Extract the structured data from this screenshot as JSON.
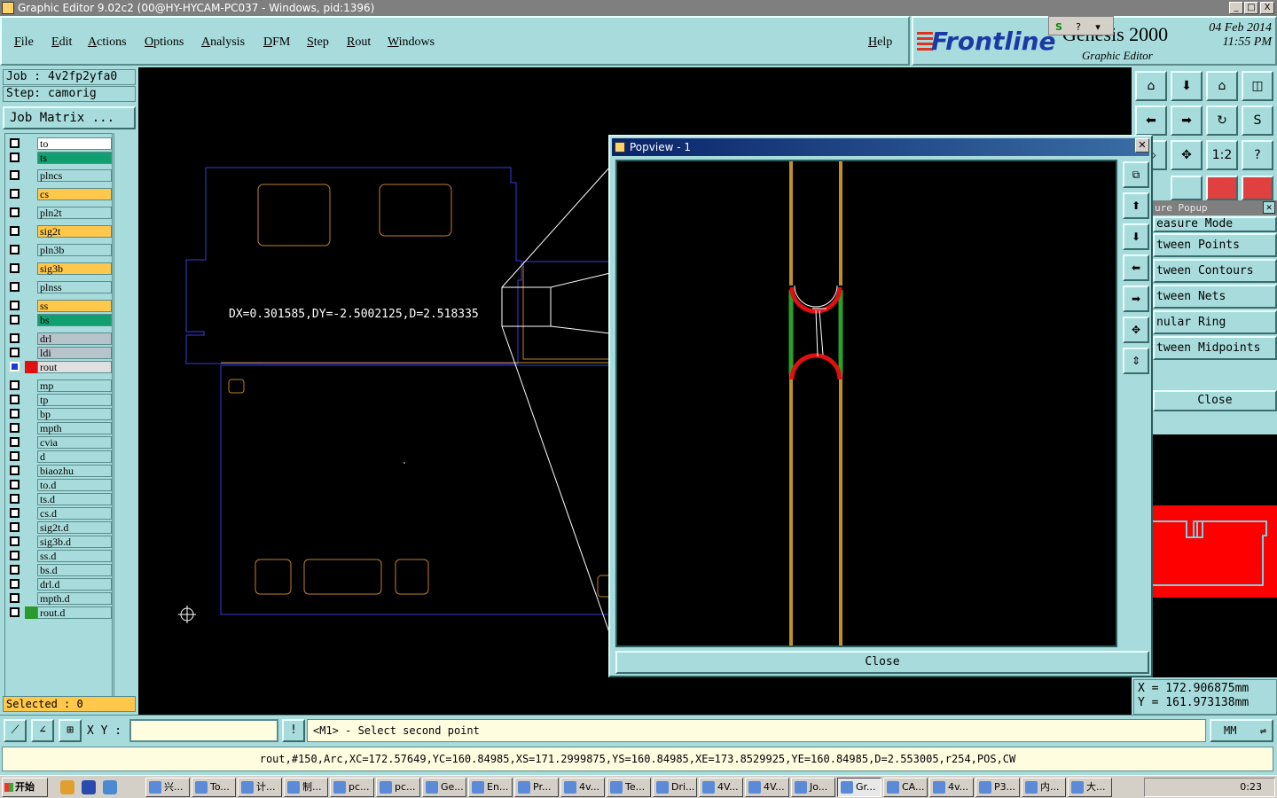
{
  "window": {
    "title": "Graphic Editor 9.02c2 (00@HY-HYCAM-PC037 - Windows, pid:1396)",
    "controls": [
      "_",
      "□",
      "X"
    ]
  },
  "menu": [
    "File",
    "Edit",
    "Actions",
    "Options",
    "Analysis",
    "DFM",
    "Step",
    "Rout",
    "Windows"
  ],
  "help": "Help",
  "branding": {
    "brand": "Frontline",
    "product": "Genesis 2000",
    "subtitle": "Graphic Editor",
    "date": "04 Feb 2014",
    "time": "11:55 PM"
  },
  "job": {
    "job_line": "Job : 4v2fp2yfa0",
    "step_line": "Step: camorig",
    "matrix_button": "Job Matrix ..."
  },
  "layers": [
    {
      "name": "to",
      "color": "#ffffff"
    },
    {
      "name": "ts",
      "color": "#10a070"
    },
    {
      "name": "plncs",
      "color": "#a8dcdc"
    },
    {
      "name": "cs",
      "color": "#ffc84a"
    },
    {
      "name": "pln2t",
      "color": "#a8dcdc"
    },
    {
      "name": "sig2t",
      "color": "#ffc84a"
    },
    {
      "name": "pln3b",
      "color": "#a8dcdc"
    },
    {
      "name": "sig3b",
      "color": "#ffc84a"
    },
    {
      "name": "plnss",
      "color": "#a8dcdc"
    },
    {
      "name": "ss",
      "color": "#ffc84a"
    },
    {
      "name": "bs",
      "color": "#10a070"
    },
    {
      "name": "drl",
      "color": "#b8c4cc"
    },
    {
      "name": "ldi",
      "color": "#b8c4cc"
    },
    {
      "name": "rout",
      "color": "#e0e0e0",
      "work": true
    },
    {
      "name": "mp",
      "color": "#a8dcdc"
    },
    {
      "name": "tp",
      "color": "#a8dcdc"
    },
    {
      "name": "bp",
      "color": "#a8dcdc"
    },
    {
      "name": "mpth",
      "color": "#a8dcdc"
    },
    {
      "name": "cvia",
      "color": "#a8dcdc"
    },
    {
      "name": "d",
      "color": "#a8dcdc"
    },
    {
      "name": "biaozhu",
      "color": "#a8dcdc"
    },
    {
      "name": "to.d",
      "color": "#a8dcdc"
    },
    {
      "name": "ts.d",
      "color": "#a8dcdc"
    },
    {
      "name": "cs.d",
      "color": "#a8dcdc"
    },
    {
      "name": "sig2t.d",
      "color": "#a8dcdc"
    },
    {
      "name": "sig3b.d",
      "color": "#a8dcdc"
    },
    {
      "name": "ss.d",
      "color": "#a8dcdc"
    },
    {
      "name": "bs.d",
      "color": "#a8dcdc"
    },
    {
      "name": "drl.d",
      "color": "#a8dcdc"
    },
    {
      "name": "mpth.d",
      "color": "#a8dcdc"
    },
    {
      "name": "rout.d",
      "color": "#a8dcdc",
      "swatch": "#2a9a2a"
    }
  ],
  "selected": "Selected : 0",
  "canvas": {
    "measure_text": "DX=0.301585,DY=-2.5002125,D=2.518335"
  },
  "popview": {
    "title": "Popview - 1",
    "close": "Close"
  },
  "measure_popup": {
    "title": "ure Popup",
    "items": [
      "easure Mode",
      "tween Points",
      "tween Contours",
      "tween Nets",
      "nular Ring",
      "tween Midpoints"
    ],
    "close": "Close"
  },
  "coords": {
    "x": "X = 172.906875mm",
    "y": "Y = 161.973138mm"
  },
  "command": {
    "xy_label": "X Y :",
    "xy_value": "",
    "prompt": "<M1> - Select second point",
    "units": "MM"
  },
  "status": "rout,#150,Arc,XC=172.57649,YC=160.84985,XS=171.2999875,YS=160.84985,XE=173.8529925,YE=160.84985,D=2.553005,r254,POS,CW",
  "taskbar": {
    "start": "开始",
    "tasks": [
      "兴...",
      "To...",
      "计...",
      "制...",
      "pc...",
      "pc...",
      "Ge...",
      "En...",
      "Pr...",
      "4v...",
      "Te...",
      "Dri...",
      "4V...",
      "4V...",
      "Jo...",
      "Gr...",
      "CA...",
      "4v...",
      "P3...",
      "内...",
      "大..."
    ],
    "active_index": 15,
    "clock": "0:23"
  }
}
